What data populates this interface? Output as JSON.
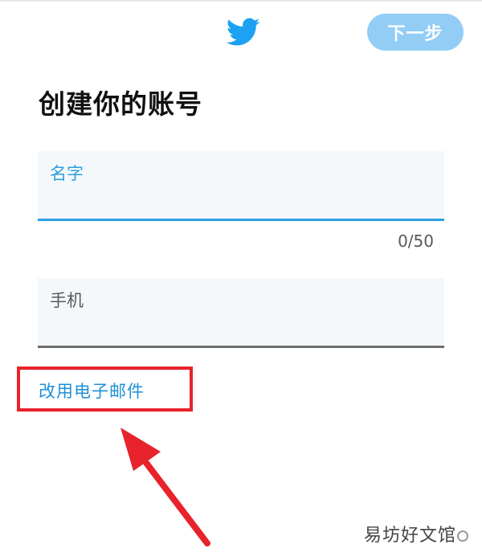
{
  "header": {
    "logo_icon": "twitter-bird-icon",
    "next_label": "下一步"
  },
  "page": {
    "title": "创建你的账号"
  },
  "form": {
    "name_label": "名字",
    "name_value": "",
    "name_counter": "0/50",
    "phone_label": "手机",
    "phone_value": "",
    "use_email_label": "改用电子邮件"
  },
  "annotation": {
    "box_color": "#e8232b",
    "arrow_icon": "red-arrow-icon"
  },
  "watermark": {
    "text": "易坊好文馆"
  },
  "colors": {
    "brand": "#1da1f2",
    "accent": "#2b9fe0",
    "next_button_bg": "#93cdf6"
  }
}
